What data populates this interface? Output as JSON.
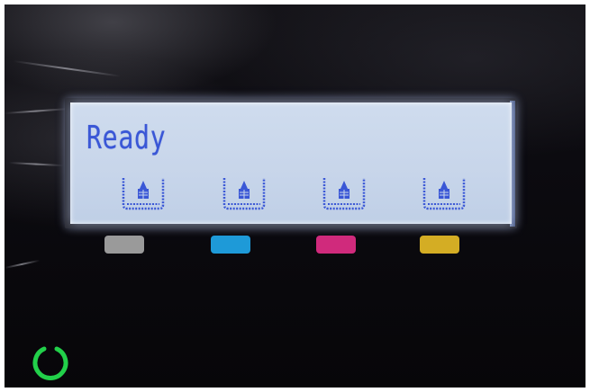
{
  "display": {
    "status_text": "Ready",
    "cartridges": [
      {
        "icon": "ink-cartridge-icon",
        "swatch_color": "#9a9a9a"
      },
      {
        "icon": "ink-cartridge-icon",
        "swatch_color": "#1e9ad8"
      },
      {
        "icon": "ink-cartridge-icon",
        "swatch_color": "#d02a7c"
      },
      {
        "icon": "ink-cartridge-icon",
        "swatch_color": "#d4ad24"
      }
    ]
  },
  "power": {
    "icon": "power-indicator-icon",
    "color": "#22d04a"
  },
  "colors": {
    "lcd_text": "#3a57d6",
    "lcd_background": "#c9d7ec"
  }
}
